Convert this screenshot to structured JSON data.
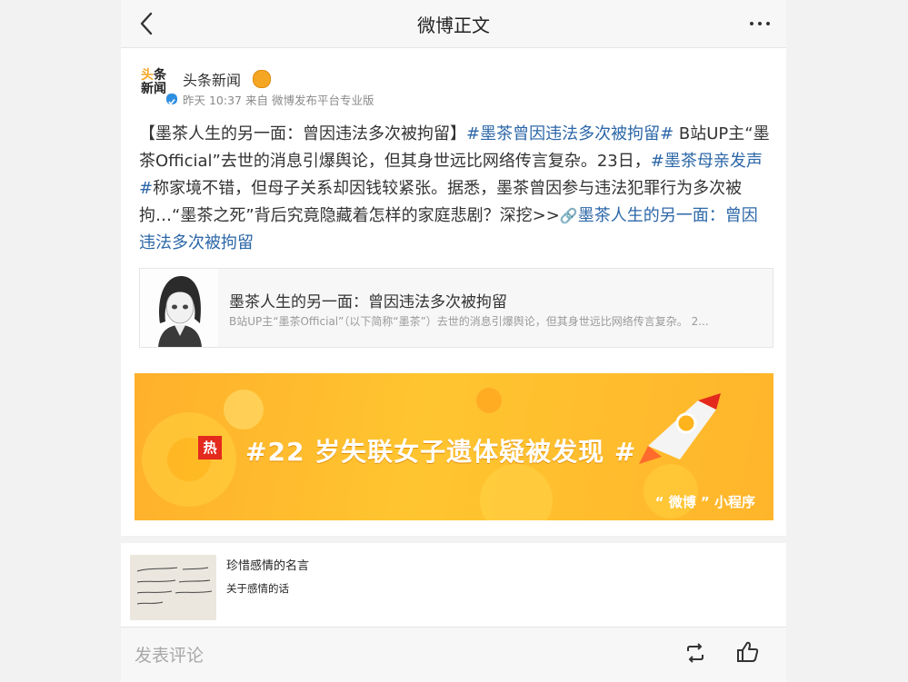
{
  "nav": {
    "title": "微博正文"
  },
  "post": {
    "avatar_text": {
      "line1_a": "头",
      "line1_b": "条",
      "line2": "新闻"
    },
    "username": "头条新闻",
    "meta": "昨天 10:37 来自 微博发布平台专业版",
    "text": {
      "p1": "【墨茶人生的另一面：曾因违法多次被拘留】",
      "tag1": "#墨茶曾因违法多次被拘留#",
      "p2": " B站UP主“墨茶Official”去世的消息引爆舆论，但其身世远比网络传言复杂。23日，",
      "tag2": "#墨茶母亲发声#",
      "p3": "称家境不错，但母子关系却因钱较紧张。据悉，墨茶曾因参与违法犯罪行为多次被拘…“墨茶之死”背后究竟隐藏着怎样的家庭悲剧？深挖>>",
      "link": "墨茶人生的另一面：曾因违法多次被拘留"
    },
    "link_card": {
      "title": "墨茶人生的另一面：曾因违法多次被拘留",
      "desc": "B站UP主“墨茶Official”（以下简称“墨茶”）去世的消息引爆舆论，但其身世远比网络传言复杂。 2..."
    },
    "banner": {
      "hot": "热",
      "text": "#22 岁失联女子遗体疑被发现 #",
      "mini_program": "“ 微博 ” 小程序"
    }
  },
  "recommend": {
    "title": "珍惜感情的名言",
    "subtitle": "关于感情的话"
  },
  "bottom": {
    "comment_placeholder": "发表评论"
  },
  "colors": {
    "tag": "#2c67a8",
    "banner": "#ffc530",
    "hot": "#e4291d"
  }
}
